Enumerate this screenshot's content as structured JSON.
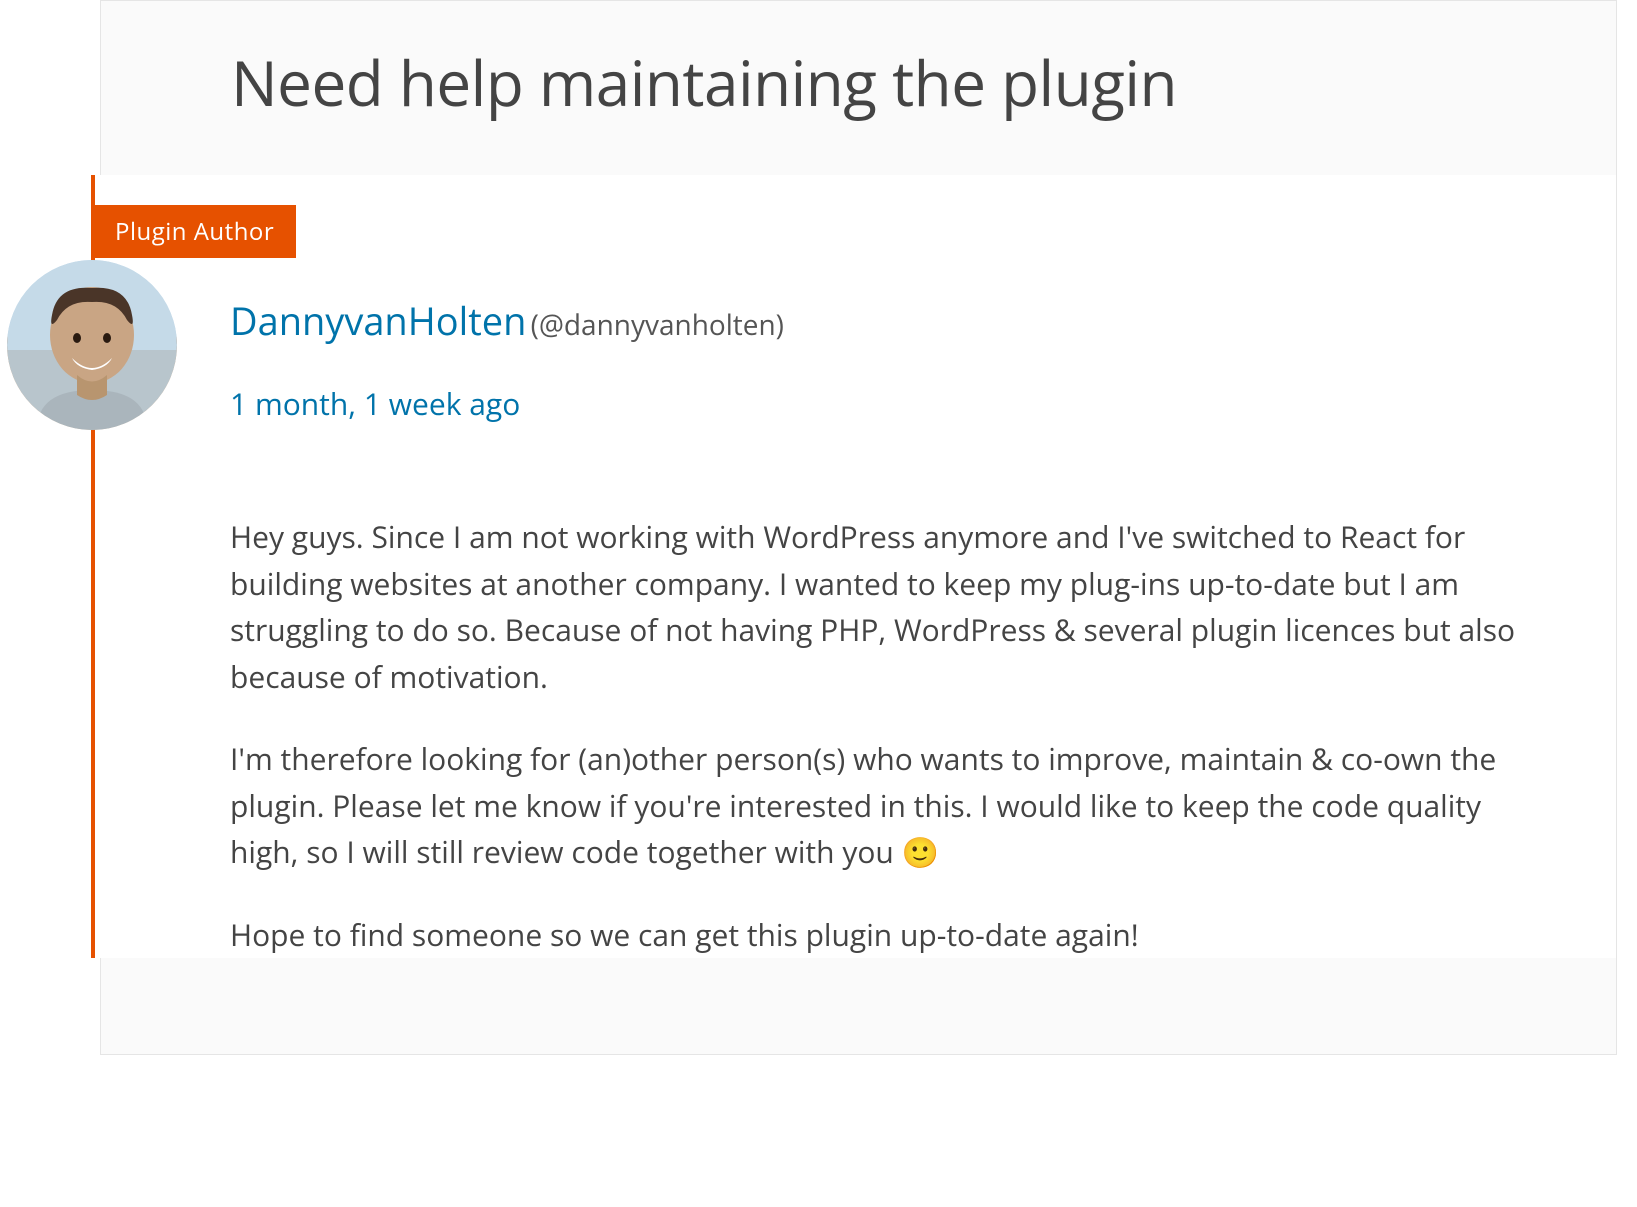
{
  "post": {
    "title": "Need help maintaining the plugin",
    "badge": "Plugin Author",
    "author": {
      "name": "DannyvanHolten",
      "handle": "(@dannyvanholten)"
    },
    "timestamp": "1 month, 1 week ago",
    "paragraphs": {
      "p1": "Hey guys. Since I am not working with WordPress anymore and I've switched to React for building websites at another company. I wanted to keep my plug-ins up-to-date but I am struggling to do so. Because of not having PHP, WordPress & several plugin licences but also because of motivation.",
      "p2": "I'm therefore looking for (an)other person(s) who wants to improve, maintain & co-own the plugin. Please let me know if you're interested in this. I would like to keep the code quality high, so I will still review code together with you 🙂",
      "p3": "Hope to find someone so we can get this plugin up-to-date again!"
    }
  }
}
